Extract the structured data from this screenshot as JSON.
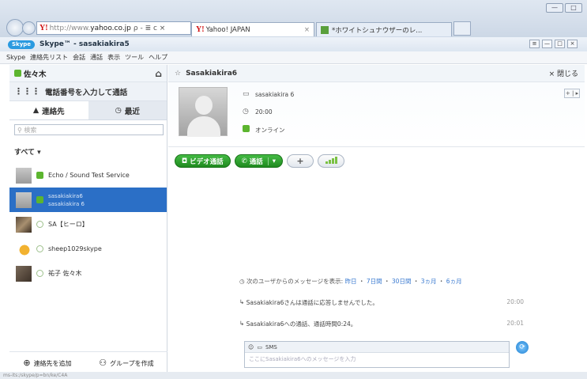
{
  "browser": {
    "address_prefix": "http://www.",
    "address_domain": "yahoo.co.jp",
    "address_tools": "ρ - ≣ c ×",
    "tabs": [
      {
        "label": "Yahoo! JAPAN",
        "close": "×"
      },
      {
        "label": "*ホワイトシュナウザーのレ...",
        "close": ""
      }
    ],
    "window_buttons": [
      "—",
      "□"
    ]
  },
  "skype": {
    "logo": "Skype",
    "title": "Skype™ - sasakiakira5",
    "window_buttons": [
      "≡",
      "—",
      "□",
      "×"
    ],
    "menu": [
      "Skype",
      "連絡先リスト",
      "会話",
      "通話",
      "表示",
      "ツール",
      "ヘルプ"
    ]
  },
  "left": {
    "user_name": "佐々木",
    "dial_label": "電話番号を入力して通話",
    "tab_contacts": "連絡先",
    "tab_recent": "最近",
    "search_placeholder": "検索",
    "group_title": "すべて ▾",
    "contacts": [
      {
        "name": "Echo / Sound Test Service",
        "sub": "",
        "status": "online"
      },
      {
        "name": "sasakiakira6",
        "sub": "sasakiakira 6",
        "status": "online"
      },
      {
        "name": "SA【ヒーロ】",
        "sub": "",
        "status": "offline"
      },
      {
        "name": "sheep1029skype",
        "sub": "",
        "status": "offline"
      },
      {
        "name": "祐子 佐々木",
        "sub": "",
        "status": "offline"
      }
    ],
    "add_contact": "連絡先を追加",
    "create_group": "グループを作成"
  },
  "right": {
    "header_name": "Sasakiakira6",
    "close_label": "× 閉じる",
    "profile": {
      "display_name": "sasakiakira 6",
      "time": "20:00",
      "status": "オンライン"
    },
    "expand_label": "+ | ▸",
    "video_call": "ビデオ通話",
    "voice_call": "通話",
    "plus": "+",
    "history_prefix": "次のユーザからのメッセージを表示:",
    "history_links": [
      "昨日",
      "7日間",
      "30日間",
      "3ヵ月",
      "6ヵ月"
    ],
    "history_separator": "・",
    "messages": [
      {
        "text": "Sasakiakira6さんは通話に応答しませんでした。",
        "time": "20:00"
      },
      {
        "text": "Sasakiakira6への通話、通話時間0:24。",
        "time": "20:01"
      }
    ],
    "chat_mode": "SMS",
    "chat_placeholder": "ここにSasakiakira6へのメッセージを入力"
  },
  "statusbar_text": "ms-its:/skype/p=bn/ke/C4A",
  "colors": {
    "accent_blue": "#2b6fc6",
    "call_green": "#2aa02a",
    "online_green": "#5cb52f"
  }
}
